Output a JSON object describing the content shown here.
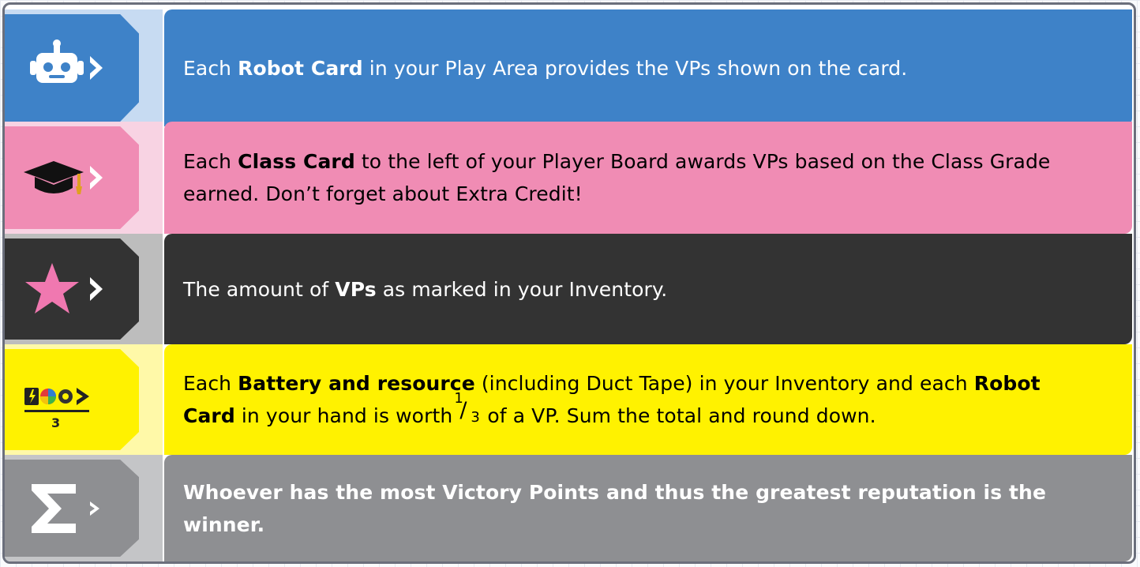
{
  "rows": [
    {
      "id": "robot",
      "icon": "robot-head-icon",
      "colors": {
        "panel": "#3e82c8",
        "strip": "#c7dbf2",
        "tab": "#3e82c8",
        "text": "#ffffff"
      },
      "pre": "Each ",
      "bold1": "Robot Card",
      "mid": " in your Play Area provides the VPs shown on the card.",
      "bold2": "",
      "post": ""
    },
    {
      "id": "class",
      "icon": "graduation-cap-icon",
      "colors": {
        "panel": "#f08cb4",
        "strip": "#f8d3e3",
        "tab": "#f08cb4",
        "text": "#000000"
      },
      "pre": "Each ",
      "bold1": "Class Card",
      "mid": " to the left of your Player Board awards VPs based on the Class Grade earned. Don’t forget about Extra Credit!",
      "bold2": "",
      "post": ""
    },
    {
      "id": "vps",
      "icon": "star-icon",
      "colors": {
        "panel": "#333333",
        "strip": "#bdbdbd",
        "tab": "#333333",
        "text": "#ffffff"
      },
      "pre": "The amount of ",
      "bold1": "VPs",
      "mid": " as marked in your Inventory.",
      "bold2": "",
      "post": ""
    },
    {
      "id": "resources",
      "icon": "battery-resources-icon",
      "colors": {
        "panel": "#fff200",
        "strip": "#fff9a8",
        "tab": "#fff200",
        "text": "#000000"
      },
      "pre": "Each ",
      "bold1": "Battery and resource",
      "mid": " (including Duct Tape) in your Inventory and each ",
      "bold2": "Robot Card",
      "post": " in your hand is worth",
      "frac": {
        "num": "1",
        "den": "3"
      },
      "tail": " of a VP. Sum the total and round down.",
      "icon_label": "3"
    },
    {
      "id": "sum",
      "icon": "sigma-icon",
      "colors": {
        "panel": "#8e8f92",
        "strip": "#c4c5c7",
        "tab": "#8e8f92",
        "text": "#ffffff"
      },
      "bold_full": "Whoever has the most Victory Points and thus the greatest reputation is the winner."
    }
  ]
}
